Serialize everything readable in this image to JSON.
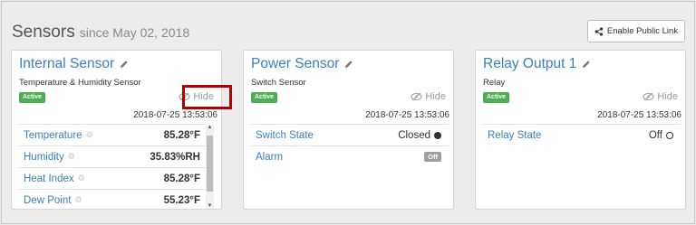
{
  "header": {
    "title": "Sensors",
    "since": "since May 02, 2018"
  },
  "public_link": {
    "label": "Enable Public Link",
    "icon": "share-icon"
  },
  "cards": [
    {
      "title": "Internal Sensor",
      "subtitle": "Temperature & Humidity Sensor",
      "status": "Active",
      "hide_label": "Hide",
      "timestamp": "2018-07-25 13:53:06",
      "rows": [
        {
          "label": "Temperature",
          "value": "85.28°F"
        },
        {
          "label": "Humidity",
          "value": "35.83%RH"
        },
        {
          "label": "Heat Index",
          "value": "85.28°F"
        },
        {
          "label": "Dew Point",
          "value": "55.23°F"
        }
      ]
    },
    {
      "title": "Power Sensor",
      "subtitle": "Switch Sensor",
      "status": "Active",
      "hide_label": "Hide",
      "timestamp": "2018-07-25 13:53:06",
      "rows": [
        {
          "label": "Switch State",
          "value": "Closed"
        },
        {
          "label": "Alarm",
          "value": "Off"
        }
      ]
    },
    {
      "title": "Relay Output 1",
      "subtitle": "Relay",
      "status": "Active",
      "hide_label": "Hide",
      "timestamp": "2018-07-25 13:53:06",
      "rows": [
        {
          "label": "Relay State",
          "value": "Off"
        }
      ]
    }
  ],
  "colors": {
    "accent": "#3a7fc1",
    "active": "#4caf50",
    "highlight": "#b30000"
  }
}
